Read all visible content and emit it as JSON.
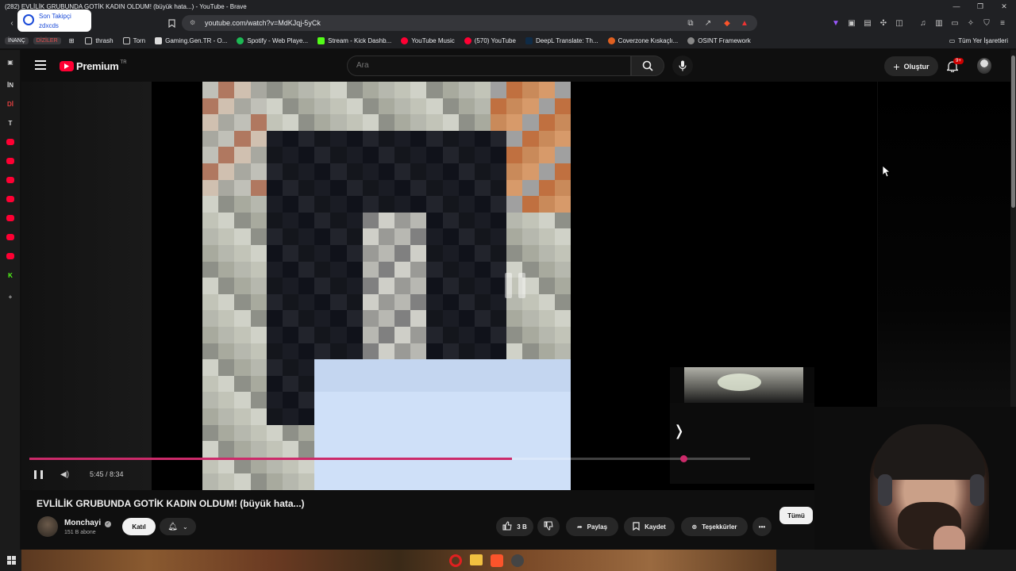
{
  "window": {
    "title": "(282) EVLİLİK GRUBUNDA GOTİK KADIN OLDUM! (büyük hata...) - YouTube - Brave"
  },
  "profile": {
    "line1": "Son Takipçi",
    "line2": "zdxcds"
  },
  "address": {
    "url": "youtube.com/watch?v=MdKJqj-5yCk"
  },
  "bookmarks": {
    "tags": [
      "İNANÇ",
      "DİZİLER"
    ],
    "items": [
      {
        "label": "thrash",
        "icon": "folder-icon",
        "color": "#c8c8c8"
      },
      {
        "label": "Torn",
        "icon": "folder-icon",
        "color": "#c8c8c8"
      },
      {
        "label": "Gaming.Gen.TR - O...",
        "icon": "gaming-icon",
        "color": "#dcdcdc"
      },
      {
        "label": "Spotify - Web Playe...",
        "icon": "spotify-icon",
        "color": "#1db954"
      },
      {
        "label": "Stream - Kick Dashb...",
        "icon": "kick-icon",
        "color": "#53fc18"
      },
      {
        "label": "YouTube Music",
        "icon": "youtube-music-icon",
        "color": "#ff0033"
      },
      {
        "label": "(570) YouTube",
        "icon": "youtube-icon",
        "color": "#ff0033"
      },
      {
        "label": "DeepL Translate: Th...",
        "icon": "deepl-icon",
        "color": "#0f2b46"
      },
      {
        "label": "Coverzone Kıskaçlı...",
        "icon": "coverzone-icon",
        "color": "#e06020"
      },
      {
        "label": "OSINT Framework",
        "icon": "osint-icon",
        "color": "#888"
      }
    ],
    "all_label": "Tüm Yer İşaretleri"
  },
  "sidebar": {
    "items": [
      {
        "label": "İN",
        "color": "#d9d9d9"
      },
      {
        "label": "Dİ",
        "color": "#e04040"
      },
      {
        "label": "T",
        "color": "#d9d9d9"
      },
      {
        "label": "",
        "color": "#ff0033"
      },
      {
        "label": "",
        "color": "#ff0033"
      },
      {
        "label": "",
        "color": "#ff0033"
      },
      {
        "label": "",
        "color": "#ff0033"
      },
      {
        "label": "",
        "color": "#ff0033"
      },
      {
        "label": "",
        "color": "#ff0033"
      },
      {
        "label": "",
        "color": "#ff0033"
      },
      {
        "label": "K",
        "color": "#53fc18"
      },
      {
        "label": "+",
        "color": "#aaa"
      }
    ]
  },
  "youtube": {
    "logo_label": "Premium",
    "region": "TR",
    "search_placeholder": "Ara",
    "create_label": "Oluştur",
    "notif_badge": "9+"
  },
  "player": {
    "time": "5:45 / 8:34",
    "progress": 0.67
  },
  "video": {
    "title": "EVLİLİK GRUBUNDA GOTİK KADIN OLDUM! (büyük hata...)",
    "channel": "Monchayi",
    "subscribers": "151 B abone",
    "join_label": "Katıl",
    "likes": "3 B",
    "share_label": "Paylaş",
    "save_label": "Kaydet",
    "thanks_label": "Teşekkürler",
    "all_label": "Tümü"
  },
  "colors": {
    "accent": "#ff0033",
    "progress": "#cc2a6a",
    "bg": "#0f0f0f"
  }
}
